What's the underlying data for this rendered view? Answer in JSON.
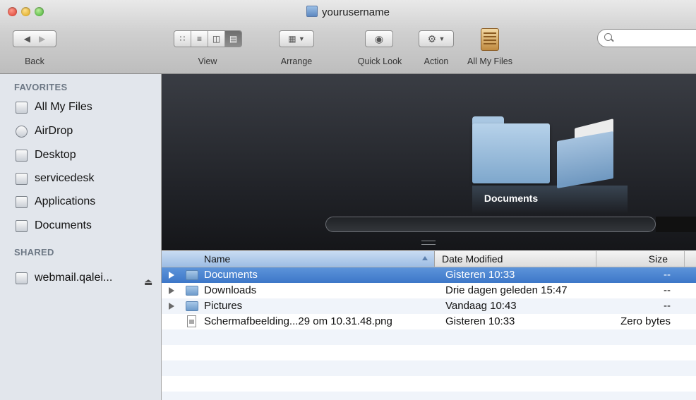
{
  "window": {
    "title": "yourusername"
  },
  "toolbar": {
    "back_label": "Back",
    "view_label": "View",
    "arrange_label": "Arrange",
    "quicklook_label": "Quick Look",
    "action_label": "Action",
    "allmyfiles_label": "All My Files",
    "view_modes": [
      "icon-view",
      "list-view",
      "column-view",
      "cover-flow-view"
    ],
    "active_view": "cover-flow-view"
  },
  "sidebar": {
    "favorites_header": "FAVORITES",
    "favorites": [
      {
        "label": "All My Files",
        "icon": "all-my-files-icon"
      },
      {
        "label": "AirDrop",
        "icon": "airdrop-icon"
      },
      {
        "label": "Desktop",
        "icon": "desktop-icon"
      },
      {
        "label": "servicedesk",
        "icon": "home-icon"
      },
      {
        "label": "Applications",
        "icon": "applications-icon"
      },
      {
        "label": "Documents",
        "icon": "documents-icon"
      }
    ],
    "shared_header": "SHARED",
    "shared": [
      {
        "label": "webmail.qalei...",
        "icon": "network-computer-icon"
      }
    ]
  },
  "coverflow": {
    "caption": "Documents"
  },
  "list": {
    "columns": {
      "name": "Name",
      "date": "Date Modified",
      "size": "Size"
    },
    "rows": [
      {
        "name": "Documents",
        "date": "Gisteren 10:33",
        "size": "--",
        "kind": "folder",
        "selected": true
      },
      {
        "name": "Downloads",
        "date": "Drie dagen geleden 15:47",
        "size": "--",
        "kind": "folder",
        "selected": false
      },
      {
        "name": "Pictures",
        "date": "Vandaag 10:43",
        "size": "--",
        "kind": "folder",
        "selected": false
      },
      {
        "name": "Schermafbeelding...29 om 10.31.48.png",
        "date": "Gisteren 10:33",
        "size": "Zero bytes",
        "kind": "file",
        "selected": false
      }
    ]
  },
  "colors": {
    "selection": "#3d77c8",
    "sidebar_bg": "#e2e6ec",
    "coverflow_bg": "#1f2126"
  }
}
